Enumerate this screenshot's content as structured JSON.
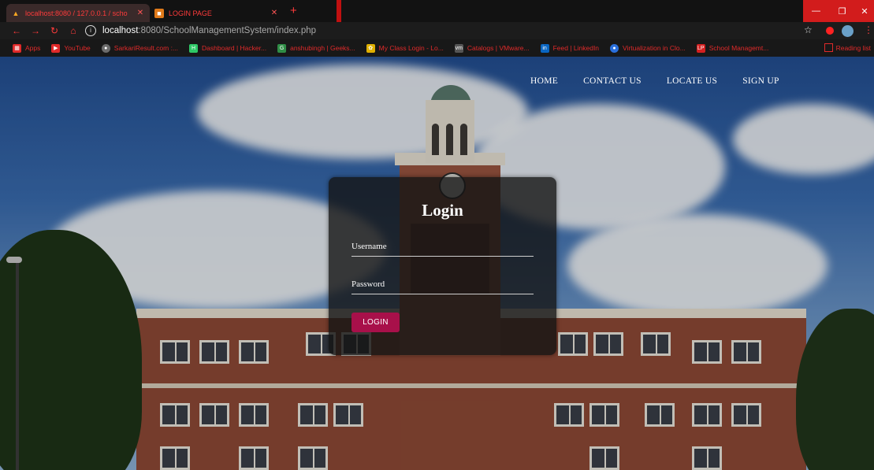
{
  "browser": {
    "tabs": [
      {
        "title": "localhost:8080 / 127.0.0.1 / scho",
        "icon": "phpmyadmin-icon",
        "active": true
      },
      {
        "title": "LOGIN PAGE",
        "icon": "page-icon",
        "active": false
      }
    ],
    "new_tab": "+",
    "url_host": "localhost",
    "url_rest": ":8080/SchoolManagementSystem/index.php",
    "bookmarks": [
      {
        "label": "Apps",
        "icon": "apps-grid-icon",
        "color": "#e02a2a"
      },
      {
        "label": "YouTube",
        "icon": "youtube-icon",
        "color": "#e02a2a"
      },
      {
        "label": "SarkariResult.com :...",
        "icon": "site-icon",
        "color": "#6b6b6b"
      },
      {
        "label": "Dashboard | Hacker...",
        "icon": "hackerrank-icon",
        "color": "#2ec866"
      },
      {
        "label": "anshubingh | Geeks...",
        "icon": "geeksforgeeks-icon",
        "color": "#2f8d46"
      },
      {
        "label": "My Class Login - Lo...",
        "icon": "class-icon",
        "color": "#e0b000"
      },
      {
        "label": "Catalogs | VMware...",
        "icon": "vmware-icon",
        "color": "#555555"
      },
      {
        "label": "Feed | LinkedIn",
        "icon": "linkedin-icon",
        "color": "#0a66c2"
      },
      {
        "label": "Virtualization in Clo...",
        "icon": "globe-icon",
        "color": "#2a6fdb"
      },
      {
        "label": "School Managemt...",
        "icon": "lp-icon",
        "color": "#d42020"
      }
    ],
    "reading_list": "Reading list",
    "accent": "#e02a2a"
  },
  "site_nav": [
    "HOME",
    "CONTACT US",
    "LOCATE US",
    "SIGN UP"
  ],
  "login": {
    "title": "Login",
    "username_label": "Username",
    "password_label": "Password",
    "button_label": "LOGIN",
    "button_color": "#a8104a"
  }
}
